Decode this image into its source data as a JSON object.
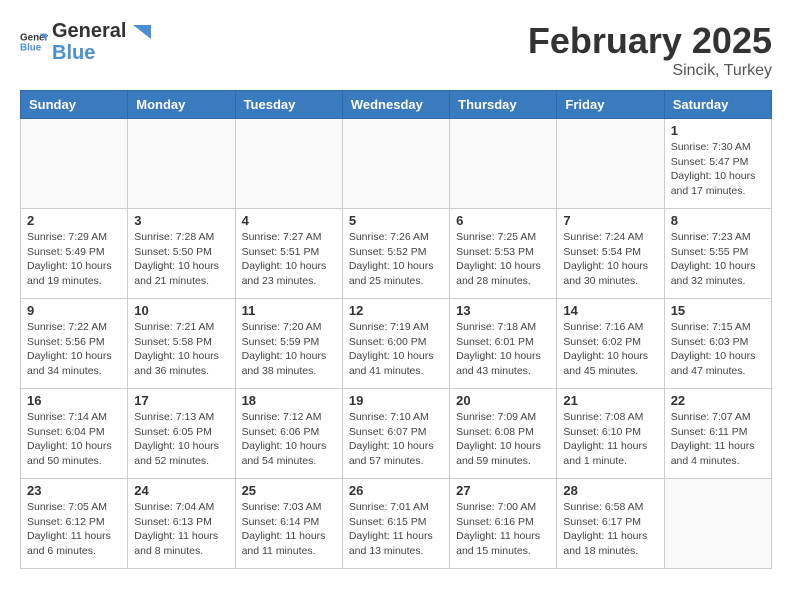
{
  "header": {
    "logo_general": "General",
    "logo_blue": "Blue",
    "month_title": "February 2025",
    "subtitle": "Sincik, Turkey"
  },
  "days_of_week": [
    "Sunday",
    "Monday",
    "Tuesday",
    "Wednesday",
    "Thursday",
    "Friday",
    "Saturday"
  ],
  "weeks": [
    [
      {
        "day": "",
        "detail": ""
      },
      {
        "day": "",
        "detail": ""
      },
      {
        "day": "",
        "detail": ""
      },
      {
        "day": "",
        "detail": ""
      },
      {
        "day": "",
        "detail": ""
      },
      {
        "day": "",
        "detail": ""
      },
      {
        "day": "1",
        "detail": "Sunrise: 7:30 AM\nSunset: 5:47 PM\nDaylight: 10 hours and 17 minutes."
      }
    ],
    [
      {
        "day": "2",
        "detail": "Sunrise: 7:29 AM\nSunset: 5:49 PM\nDaylight: 10 hours and 19 minutes."
      },
      {
        "day": "3",
        "detail": "Sunrise: 7:28 AM\nSunset: 5:50 PM\nDaylight: 10 hours and 21 minutes."
      },
      {
        "day": "4",
        "detail": "Sunrise: 7:27 AM\nSunset: 5:51 PM\nDaylight: 10 hours and 23 minutes."
      },
      {
        "day": "5",
        "detail": "Sunrise: 7:26 AM\nSunset: 5:52 PM\nDaylight: 10 hours and 25 minutes."
      },
      {
        "day": "6",
        "detail": "Sunrise: 7:25 AM\nSunset: 5:53 PM\nDaylight: 10 hours and 28 minutes."
      },
      {
        "day": "7",
        "detail": "Sunrise: 7:24 AM\nSunset: 5:54 PM\nDaylight: 10 hours and 30 minutes."
      },
      {
        "day": "8",
        "detail": "Sunrise: 7:23 AM\nSunset: 5:55 PM\nDaylight: 10 hours and 32 minutes."
      }
    ],
    [
      {
        "day": "9",
        "detail": "Sunrise: 7:22 AM\nSunset: 5:56 PM\nDaylight: 10 hours and 34 minutes."
      },
      {
        "day": "10",
        "detail": "Sunrise: 7:21 AM\nSunset: 5:58 PM\nDaylight: 10 hours and 36 minutes."
      },
      {
        "day": "11",
        "detail": "Sunrise: 7:20 AM\nSunset: 5:59 PM\nDaylight: 10 hours and 38 minutes."
      },
      {
        "day": "12",
        "detail": "Sunrise: 7:19 AM\nSunset: 6:00 PM\nDaylight: 10 hours and 41 minutes."
      },
      {
        "day": "13",
        "detail": "Sunrise: 7:18 AM\nSunset: 6:01 PM\nDaylight: 10 hours and 43 minutes."
      },
      {
        "day": "14",
        "detail": "Sunrise: 7:16 AM\nSunset: 6:02 PM\nDaylight: 10 hours and 45 minutes."
      },
      {
        "day": "15",
        "detail": "Sunrise: 7:15 AM\nSunset: 6:03 PM\nDaylight: 10 hours and 47 minutes."
      }
    ],
    [
      {
        "day": "16",
        "detail": "Sunrise: 7:14 AM\nSunset: 6:04 PM\nDaylight: 10 hours and 50 minutes."
      },
      {
        "day": "17",
        "detail": "Sunrise: 7:13 AM\nSunset: 6:05 PM\nDaylight: 10 hours and 52 minutes."
      },
      {
        "day": "18",
        "detail": "Sunrise: 7:12 AM\nSunset: 6:06 PM\nDaylight: 10 hours and 54 minutes."
      },
      {
        "day": "19",
        "detail": "Sunrise: 7:10 AM\nSunset: 6:07 PM\nDaylight: 10 hours and 57 minutes."
      },
      {
        "day": "20",
        "detail": "Sunrise: 7:09 AM\nSunset: 6:08 PM\nDaylight: 10 hours and 59 minutes."
      },
      {
        "day": "21",
        "detail": "Sunrise: 7:08 AM\nSunset: 6:10 PM\nDaylight: 11 hours and 1 minute."
      },
      {
        "day": "22",
        "detail": "Sunrise: 7:07 AM\nSunset: 6:11 PM\nDaylight: 11 hours and 4 minutes."
      }
    ],
    [
      {
        "day": "23",
        "detail": "Sunrise: 7:05 AM\nSunset: 6:12 PM\nDaylight: 11 hours and 6 minutes."
      },
      {
        "day": "24",
        "detail": "Sunrise: 7:04 AM\nSunset: 6:13 PM\nDaylight: 11 hours and 8 minutes."
      },
      {
        "day": "25",
        "detail": "Sunrise: 7:03 AM\nSunset: 6:14 PM\nDaylight: 11 hours and 11 minutes."
      },
      {
        "day": "26",
        "detail": "Sunrise: 7:01 AM\nSunset: 6:15 PM\nDaylight: 11 hours and 13 minutes."
      },
      {
        "day": "27",
        "detail": "Sunrise: 7:00 AM\nSunset: 6:16 PM\nDaylight: 11 hours and 15 minutes."
      },
      {
        "day": "28",
        "detail": "Sunrise: 6:58 AM\nSunset: 6:17 PM\nDaylight: 11 hours and 18 minutes."
      },
      {
        "day": "",
        "detail": ""
      }
    ]
  ]
}
